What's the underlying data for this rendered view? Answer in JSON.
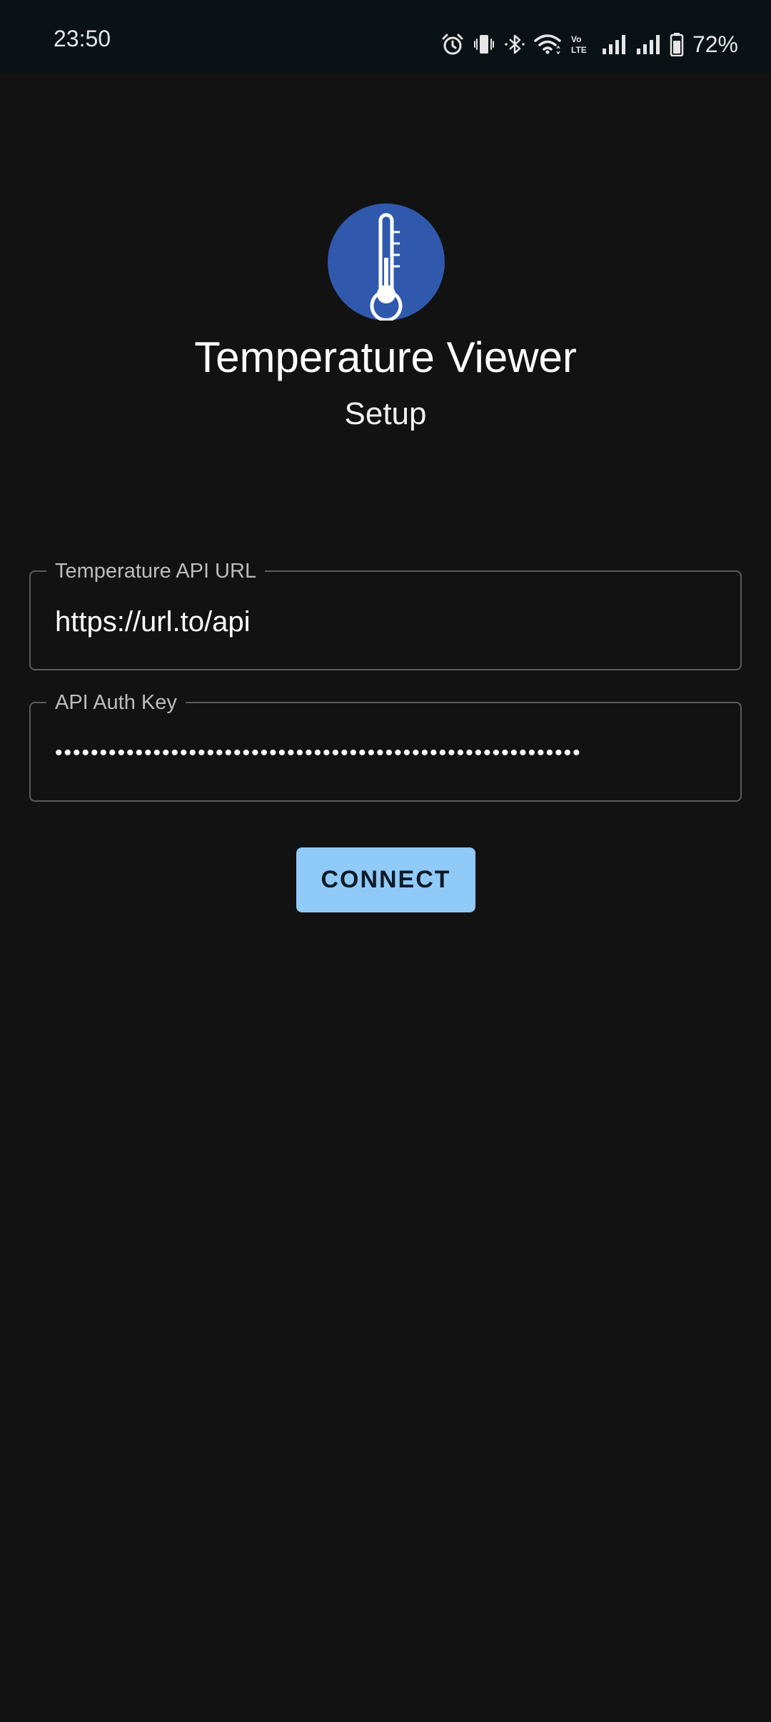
{
  "status_bar": {
    "time": "23:50",
    "battery_percent": "72%",
    "icons": [
      "alarm-icon",
      "vibrate-icon",
      "bluetooth-icon",
      "wifi-icon",
      "volte-icon",
      "signal-icon",
      "signal-icon",
      "battery-icon"
    ]
  },
  "header": {
    "app_icon": "thermometer-icon",
    "title": "Temperature Viewer",
    "subtitle": "Setup"
  },
  "form": {
    "url_field": {
      "label": "Temperature API URL",
      "value": "https://url.to/api"
    },
    "key_field": {
      "label": "API Auth Key",
      "masked_value": "•••••••••••••••••••••••••••••••••••••••••••••••••••••••••••"
    },
    "connect_label": "CONNECT"
  },
  "colors": {
    "background": "#121212",
    "status_bar": "#0a1216",
    "app_icon_bg": "#3059ae",
    "button_bg": "#90caf9",
    "button_text": "#0d1a26",
    "field_border": "#5c5c5c",
    "label_text": "#bdbdbd"
  }
}
